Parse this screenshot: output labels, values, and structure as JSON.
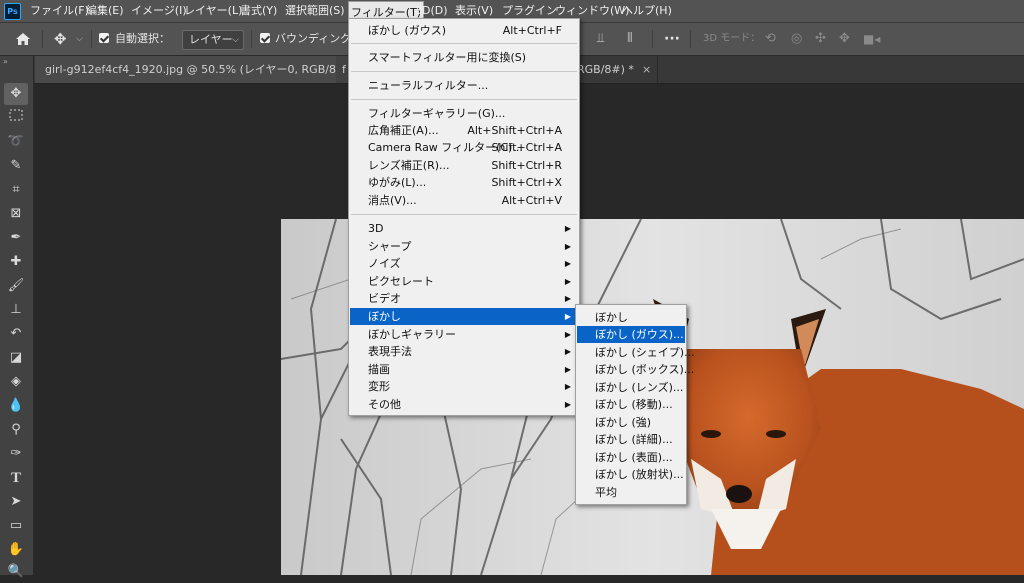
{
  "app": {
    "logo": "Ps"
  },
  "menubar": {
    "items": [
      {
        "label": "ファイル(F)"
      },
      {
        "label": "編集(E)"
      },
      {
        "label": "イメージ(I)"
      },
      {
        "label": "レイヤー(L)"
      },
      {
        "label": "書式(Y)"
      },
      {
        "label": "選択範囲(S)"
      },
      {
        "label": "フィルター(T)"
      },
      {
        "label": "3D(D)"
      },
      {
        "label": "表示(V)"
      },
      {
        "label": "プラグイン"
      },
      {
        "label": "ウィンドウ(W)"
      },
      {
        "label": "ヘルプ(H)"
      }
    ]
  },
  "options": {
    "auto_select_label": "自動選択：",
    "layer_dropdown": "レイヤー",
    "bounding_label": "バウンディングボ",
    "three_d_mode": "3D モード："
  },
  "tabs": [
    {
      "label": "girl-g912ef4cf4_1920.jpg @ 50.5% (レイヤー0, RGB/8#) *",
      "close": "×"
    },
    {
      "label": "f",
      "close": ""
    },
    {
      "label": "RGB/8#) *",
      "close": "×"
    }
  ],
  "toolbar": {
    "expand": "»"
  },
  "filter_menu": {
    "items": [
      {
        "label": "ぼかし (ガウス)",
        "shortcut": "Alt+Ctrl+F"
      },
      {
        "sep": true
      },
      {
        "label": "スマートフィルター用に変換(S)",
        "shortcut": ""
      },
      {
        "sep": true
      },
      {
        "label": "ニューラルフィルター...",
        "shortcut": ""
      },
      {
        "sep": true
      },
      {
        "label": "フィルターギャラリー(G)...",
        "shortcut": ""
      },
      {
        "label": "広角補正(A)...",
        "shortcut": "Alt+Shift+Ctrl+A"
      },
      {
        "label": "Camera Raw フィルター(C)...",
        "shortcut": "Shift+Ctrl+A"
      },
      {
        "label": "レンズ補正(R)...",
        "shortcut": "Shift+Ctrl+R"
      },
      {
        "label": "ゆがみ(L)...",
        "shortcut": "Shift+Ctrl+X"
      },
      {
        "label": "消点(V)...",
        "shortcut": "Alt+Ctrl+V"
      },
      {
        "sep": true
      },
      {
        "label": "3D",
        "arrow": "▶"
      },
      {
        "label": "シャープ",
        "arrow": "▶"
      },
      {
        "label": "ノイズ",
        "arrow": "▶"
      },
      {
        "label": "ピクセレート",
        "arrow": "▶"
      },
      {
        "label": "ビデオ",
        "arrow": "▶"
      },
      {
        "label": "ぼかし",
        "arrow": "▶",
        "highlighted": true
      },
      {
        "label": "ぼかしギャラリー",
        "arrow": "▶"
      },
      {
        "label": "表現手法",
        "arrow": "▶"
      },
      {
        "label": "描画",
        "arrow": "▶"
      },
      {
        "label": "変形",
        "arrow": "▶"
      },
      {
        "label": "その他",
        "arrow": "▶"
      }
    ]
  },
  "blur_submenu": {
    "items": [
      {
        "label": "ぼかし"
      },
      {
        "label": "ぼかし (ガウス)...",
        "highlighted": true
      },
      {
        "label": "ぼかし (シェイプ)..."
      },
      {
        "label": "ぼかし (ボックス)..."
      },
      {
        "label": "ぼかし (レンズ)..."
      },
      {
        "label": "ぼかし (移動)..."
      },
      {
        "label": "ぼかし (強)"
      },
      {
        "label": "ぼかし (詳細)..."
      },
      {
        "label": "ぼかし (表面)..."
      },
      {
        "label": "ぼかし (放射状)..."
      },
      {
        "label": "平均"
      }
    ]
  },
  "colors": {
    "highlight": "#0a64c8",
    "menu_bg": "#f0f0f0",
    "chrome": "#535353"
  }
}
